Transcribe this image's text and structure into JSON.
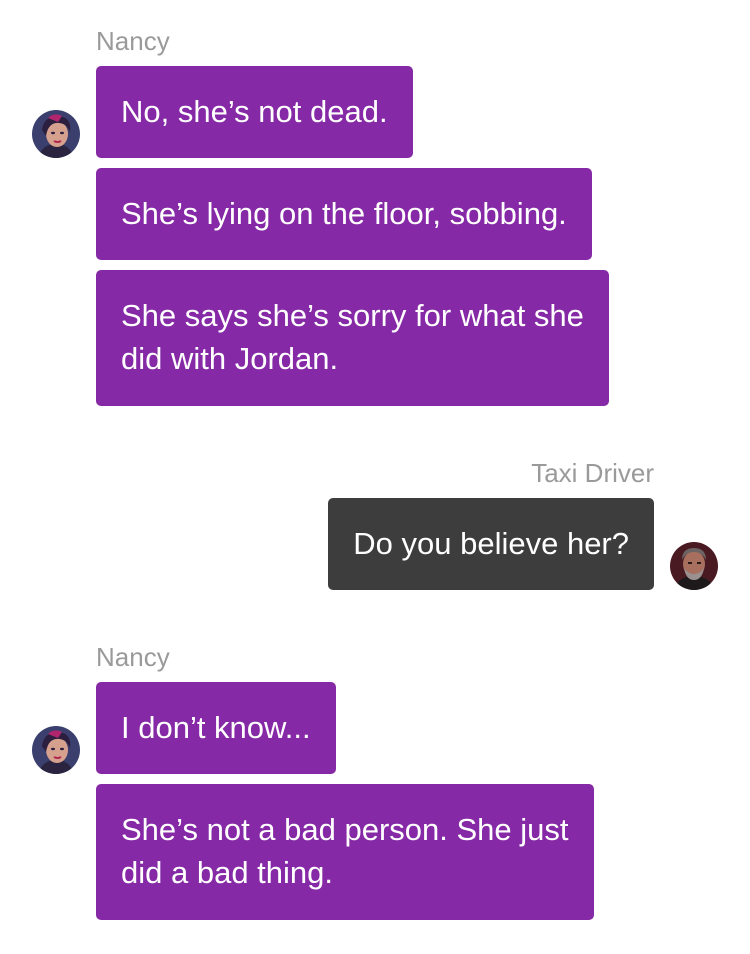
{
  "colors": {
    "incoming_bubble": "#8629a6",
    "outgoing_bubble": "#3d3d3d",
    "sender_label": "#9a9a9a",
    "background": "#ffffff"
  },
  "messages": [
    {
      "sender": "Nancy",
      "avatar_icon": "nancy-avatar",
      "lines": [
        "No, she’s not dead."
      ]
    },
    {
      "lines": [
        "She’s lying on the floor, sobbing."
      ]
    },
    {
      "lines": [
        "She says she’s sorry for what she",
        "did with Jordan."
      ]
    },
    {
      "sender": "Taxi Driver",
      "avatar_icon": "taxi-driver-avatar",
      "lines": [
        "Do you believe her?"
      ]
    },
    {
      "sender": "Nancy",
      "avatar_icon": "nancy-avatar",
      "lines": [
        "I don’t know..."
      ]
    },
    {
      "lines": [
        "She’s not a bad person. She just",
        "did a bad thing."
      ]
    }
  ]
}
